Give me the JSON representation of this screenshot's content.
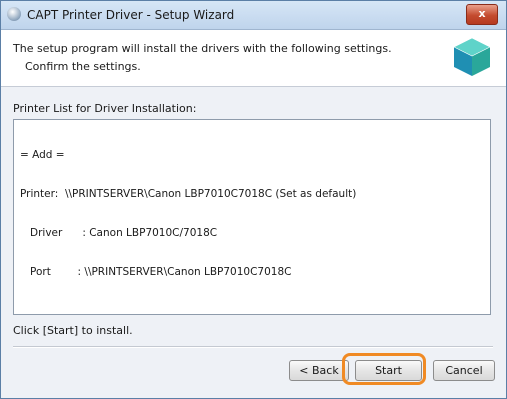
{
  "window": {
    "title": "CAPT Printer Driver - Setup Wizard",
    "close_label": "x"
  },
  "header": {
    "line1": "The setup program will install the drivers with the following settings.",
    "line2": "Confirm the settings.",
    "icon": "cube-icon"
  },
  "printer_list": {
    "label": "Printer List for Driver Installation:",
    "lines": [
      "= Add =",
      "Printer:  \\\\PRINTSERVER\\Canon LBP7010C7018C (Set as default)",
      "   Driver      : Canon LBP7010C/7018C",
      "   Port        : \\\\PRINTSERVER\\Canon LBP7010C7018C"
    ]
  },
  "instruction": "Click [Start] to install.",
  "buttons": {
    "back": "< Back",
    "start": "Start",
    "cancel": "Cancel"
  },
  "colors": {
    "highlight_ring": "#f08a24",
    "titlebar": "#c9dcf0"
  }
}
